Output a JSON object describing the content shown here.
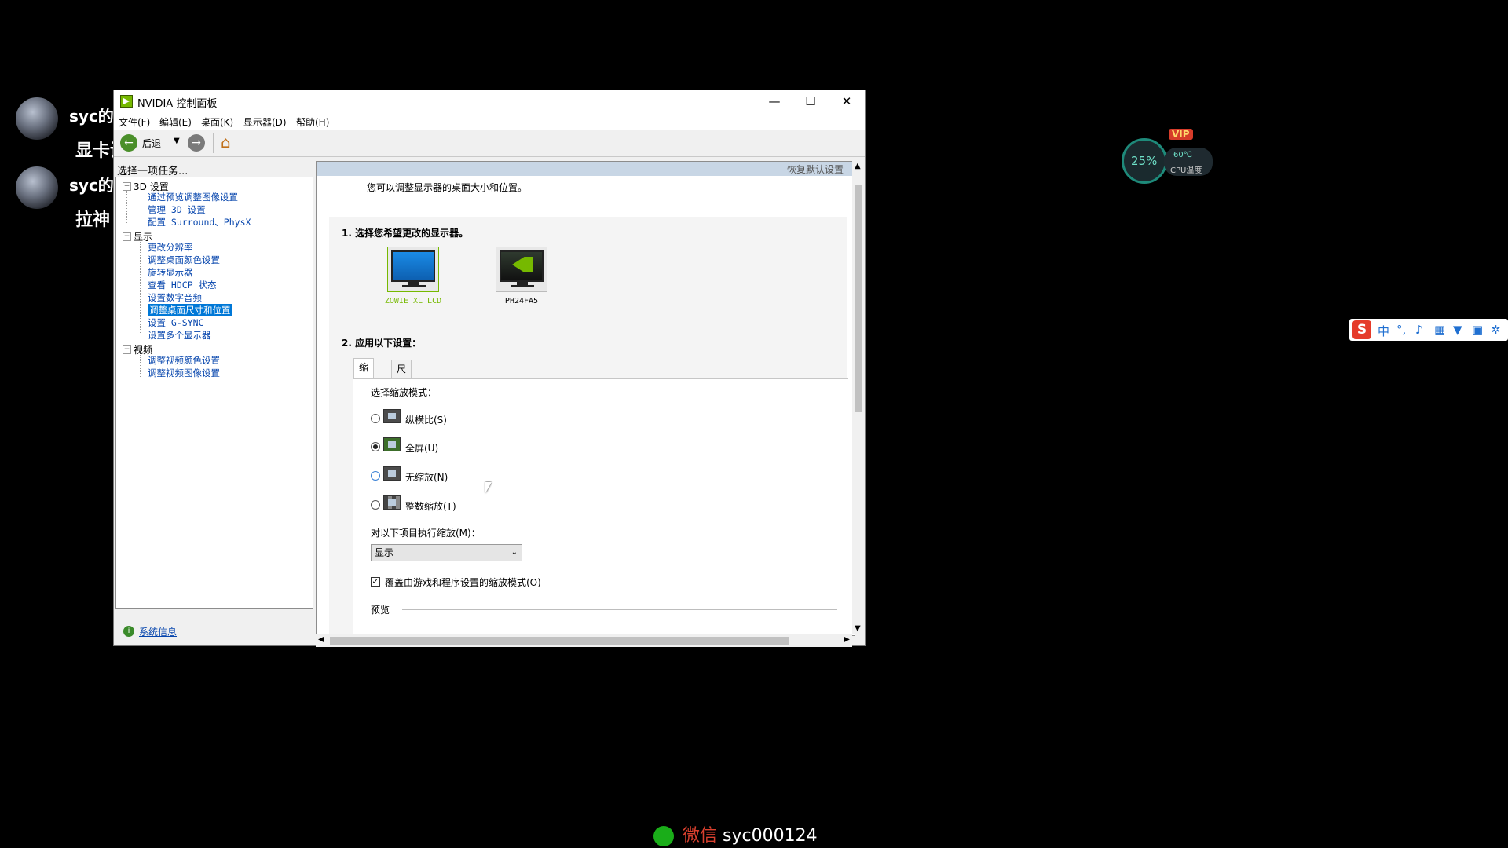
{
  "chat": {
    "user1": "syc的c",
    "msg1": "显卡设置",
    "user2": "syc的c",
    "msg2": "拉神"
  },
  "window": {
    "title": "NVIDIA 控制面板",
    "min": "—",
    "max": "☐",
    "close": "✕"
  },
  "menu": [
    "文件(F)",
    "编辑(E)",
    "桌面(K)",
    "显示器(D)",
    "帮助(H)"
  ],
  "toolbar": {
    "back": "后退",
    "forward": "→"
  },
  "left": {
    "header": "选择一项任务...",
    "categories": [
      "3D 设置",
      "显示",
      "视频"
    ],
    "items_3d": [
      "通过预览调整图像设置",
      "管理 3D 设置",
      "配置 Surround、PhysX"
    ],
    "items_display": [
      "更改分辨率",
      "调整桌面颜色设置",
      "旋转显示器",
      "查看 HDCP 状态",
      "设置数字音频",
      "调整桌面尺寸和位置",
      "设置 G-SYNC",
      "设置多个显示器"
    ],
    "items_video": [
      "调整视频颜色设置",
      "调整视频图像设置"
    ],
    "footer_link": "系统信息"
  },
  "right": {
    "restore_defaults": "恢复默认设置",
    "description": "您可以调整显示器的桌面大小和位置。",
    "step1": "1. 选择您希望更改的显示器。",
    "monitor1": "ZOWIE XL LCD",
    "monitor2": "PH24FA5",
    "step2": "2. 应用以下设置：",
    "tab_scale": "缩放",
    "tab_size": "尺寸",
    "select_mode": "选择缩放模式：",
    "opt_aspect": "纵横比(S)",
    "opt_full": "全屏(U)",
    "opt_none": "无缩放(N)",
    "opt_integer": "整数缩放(T)",
    "perform_on": "对以下项目执行缩放(M)：",
    "perform_value": "显示",
    "override": "覆盖由游戏和程序设置的缩放模式(O)",
    "preview": "预览"
  },
  "widget": {
    "cpu_percent": "25%",
    "vip": "VIP",
    "temp": "60℃",
    "temp_label": "CPU温度"
  },
  "ime": {
    "logo": "S",
    "lang": "中"
  },
  "watermark": {
    "app": "微信",
    "id": "syc000124"
  },
  "colors": {
    "nvidia_green": "#76b900",
    "link_blue": "#0645ad",
    "selection": "#0078d7"
  }
}
